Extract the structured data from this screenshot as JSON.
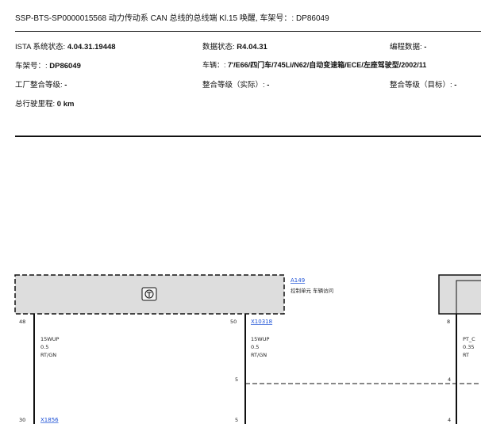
{
  "header": {
    "title": "SSP-BTS-SP0000015568 动力传动系 CAN 总线的总线端 Kl.15 唤醒, 车架号：: DP86049"
  },
  "info": {
    "ista_label": "ISTA 系统状态: ",
    "ista_value": "4.04.31.19448",
    "data_label": "数据状态: ",
    "data_value": "R4.04.31",
    "prog_label": "编程数据: ",
    "prog_value": "-",
    "vin_label": "车架号：: ",
    "vin_value": "DP86049",
    "vehicle_label": "车辆：: ",
    "vehicle_value": "7'/E66/四门车/745Li/N62/自动变速箱/ECE/左座驾驶型/2002/11",
    "factory_label": "工厂整合等级: ",
    "factory_value": "-",
    "actual_label": "整合等级（实际）: ",
    "actual_value": "-",
    "target_label": "整合等级（目标）: ",
    "target_value": "-",
    "mileage_label": "总行驶里程: ",
    "mileage_value": "0 km"
  },
  "diagram": {
    "module_id": "A149",
    "module_desc": "控制单元 车辆访问",
    "pin_48": "48",
    "pin_50": "50",
    "pin_8": "8",
    "connector_1": "X10318",
    "wire1_name": "15WUP",
    "wire1_size": "0.5",
    "wire1_color": "RT/GN",
    "wire2_name": "15WUP",
    "wire2_size": "0.5",
    "wire2_color": "RT/GN",
    "wire3_name": "PT_C",
    "wire3_size": "0.35",
    "wire3_color": "RT",
    "pin_5a": "5",
    "pin_4a": "4",
    "pin_30": "30",
    "connector_2": "X1856",
    "pin_5b": "5",
    "pin_4b": "4"
  }
}
